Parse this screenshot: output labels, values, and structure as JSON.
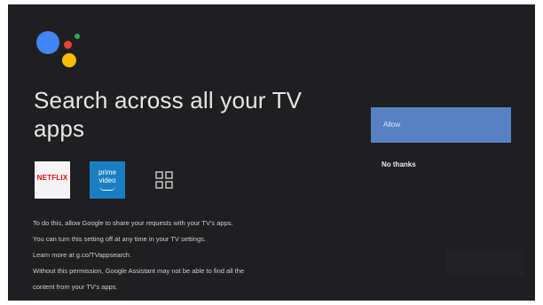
{
  "colors": {
    "background": "#1f1f21",
    "allow_button": "#5781c3",
    "assistant_blue": "#4285f4",
    "assistant_red": "#ea4335",
    "assistant_yellow": "#fbbc04",
    "assistant_green": "#34a853",
    "netflix_red": "#e50914",
    "prime_blue": "#1a7fc2"
  },
  "icons": {
    "assistant": "google-assistant-icon",
    "netflix": "netflix-app-icon",
    "prime": "prime-video-app-icon",
    "apps": "apps-grid-icon"
  },
  "main": {
    "title": "Search across all your TV apps",
    "apps": {
      "netflix_label": "NETFLIX",
      "prime_label_line1": "prime",
      "prime_label_line2": "video"
    },
    "body": [
      "To do this, allow Google to share your requests with your TV's apps.",
      "You can turn this setting off at any time in your TV settings.",
      "Learn more at g.co/TVappsearch.",
      "Without this permission, Google Assistant may not be able to find all the",
      "content from your TV's apps."
    ]
  },
  "actions": {
    "allow_label": "Allow",
    "no_thanks_label": "No thanks"
  }
}
